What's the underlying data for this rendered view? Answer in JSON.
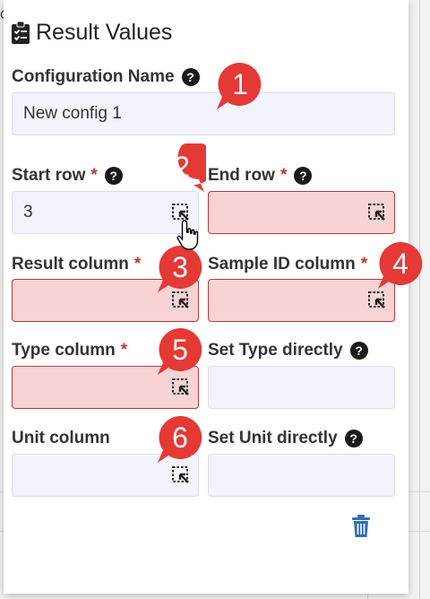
{
  "panel": {
    "title": "Result Values"
  },
  "fields": {
    "config_name": {
      "label": "Configuration Name",
      "value": "New config 1"
    },
    "start_row": {
      "label": "Start row",
      "value": "3",
      "required": "*"
    },
    "end_row": {
      "label": "End row",
      "value": "",
      "required": "*"
    },
    "result_column": {
      "label": "Result column",
      "value": "",
      "required": "*"
    },
    "sample_id_column": {
      "label": "Sample ID column",
      "value": "",
      "required": "*"
    },
    "type_column": {
      "label": "Type column",
      "value": "",
      "required": "*"
    },
    "set_type_directly": {
      "label": "Set Type directly",
      "value": ""
    },
    "unit_column": {
      "label": "Unit column",
      "value": ""
    },
    "set_unit_directly": {
      "label": "Set Unit directly",
      "value": ""
    }
  },
  "help_glyph": "?",
  "annotations": [
    "1",
    "2",
    "3",
    "4",
    "5",
    "6"
  ],
  "colors": {
    "badge": "#e53935",
    "error_fill": "#f7d4d3",
    "error_border": "#b53a3a",
    "trash": "#2f6fb0"
  },
  "background": {
    "corner_char": "G"
  }
}
